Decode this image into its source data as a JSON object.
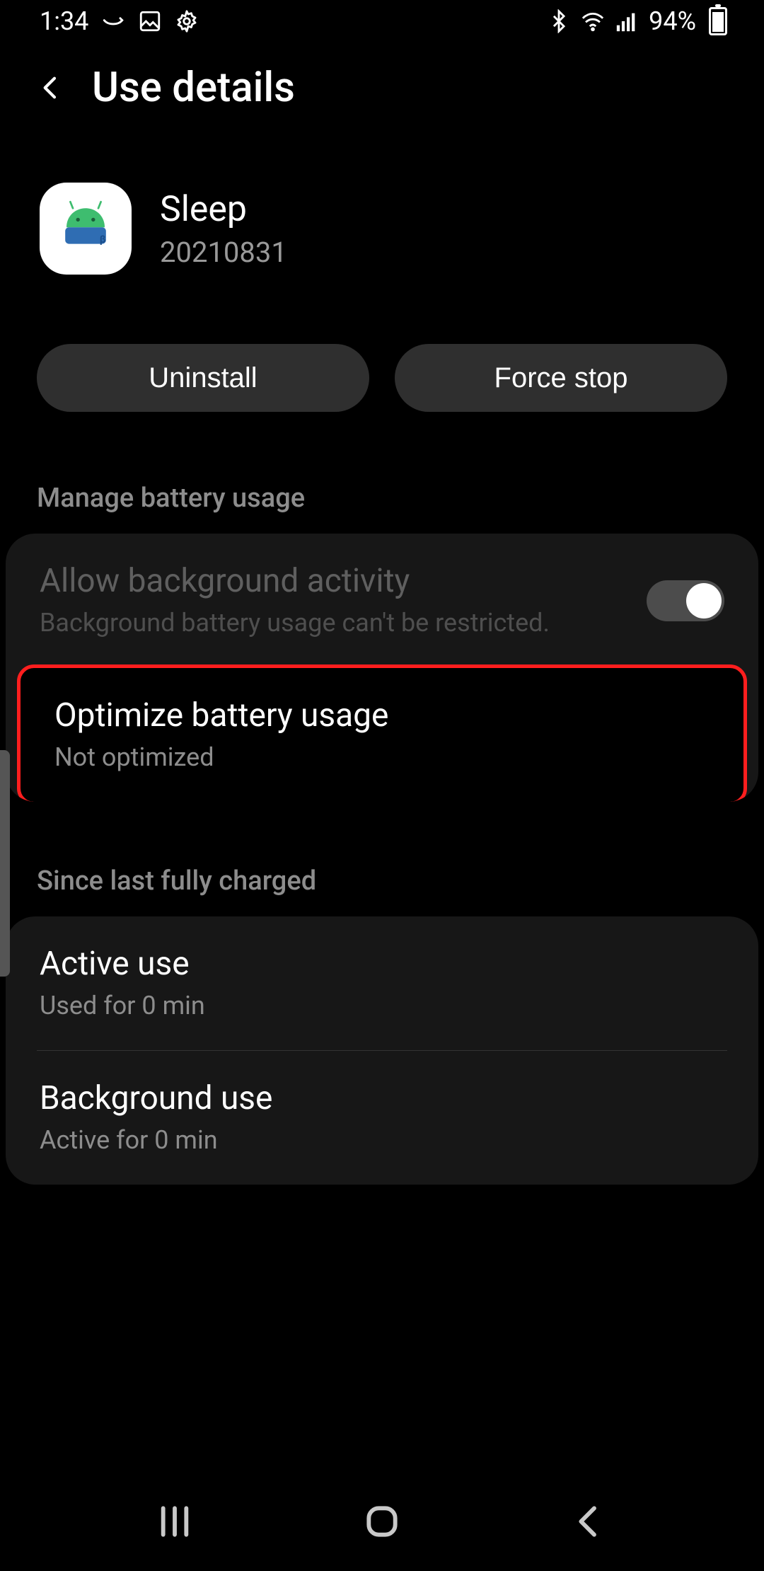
{
  "status": {
    "time": "1:34",
    "battery_pct": "94%"
  },
  "header": {
    "title": "Use details"
  },
  "app": {
    "name": "Sleep",
    "version": "20210831"
  },
  "buttons": {
    "uninstall": "Uninstall",
    "force_stop": "Force stop"
  },
  "sections": {
    "manage": "Manage battery usage",
    "since": "Since last fully charged"
  },
  "rows": {
    "bg_activity": {
      "title": "Allow background activity",
      "sub": "Background battery usage can't be restricted.",
      "toggle_on": true
    },
    "optimize": {
      "title": "Optimize battery usage",
      "sub": "Not optimized"
    },
    "active": {
      "title": "Active use",
      "sub": "Used for 0 min"
    },
    "background": {
      "title": "Background use",
      "sub": "Active for 0 min"
    }
  }
}
